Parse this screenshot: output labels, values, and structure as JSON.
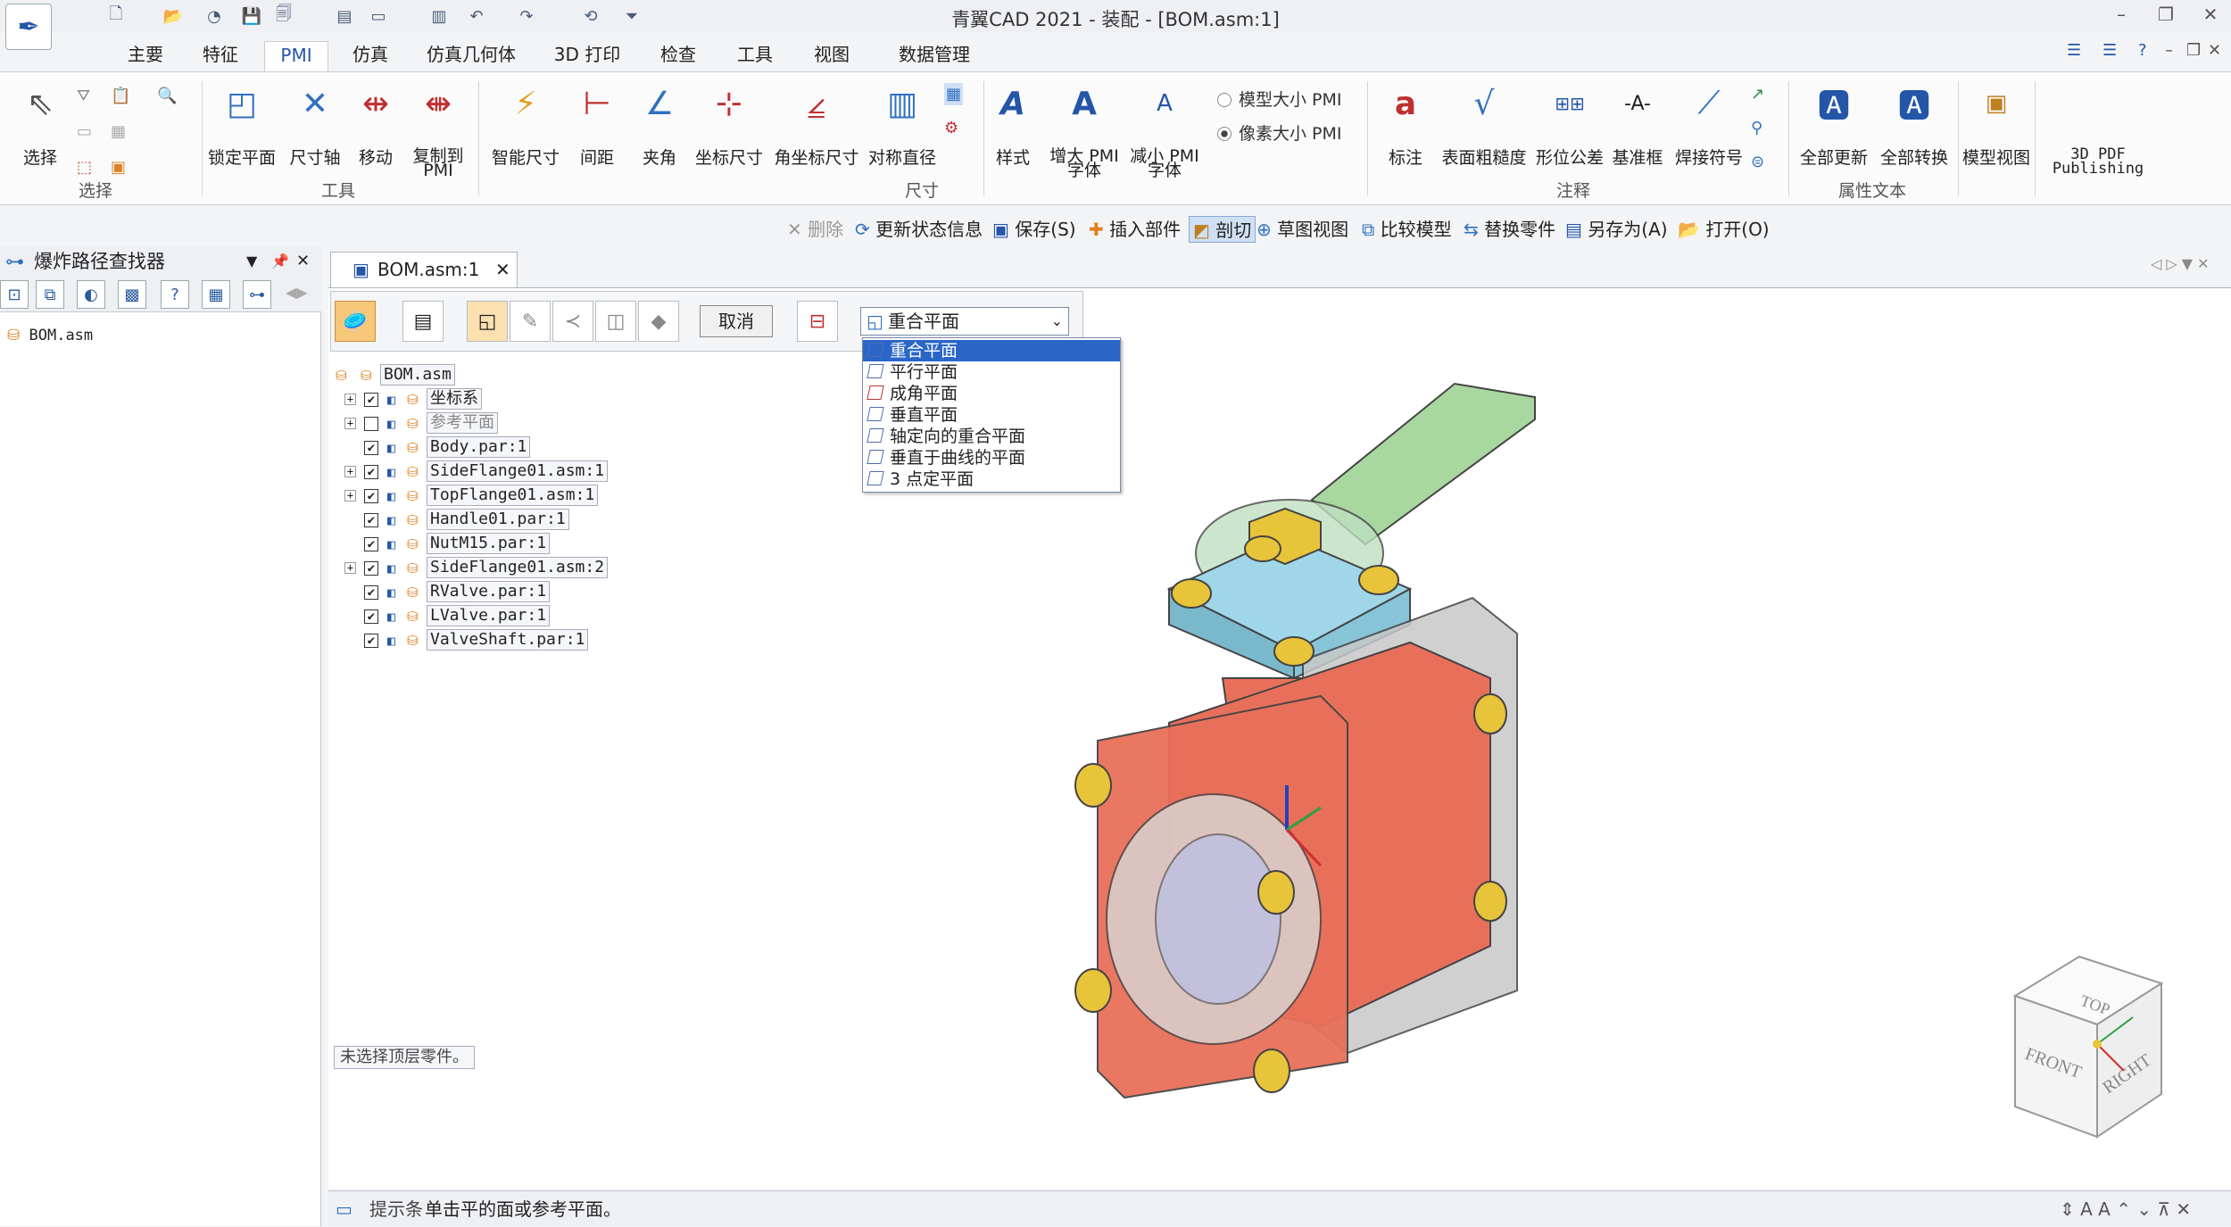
{
  "window": {
    "title": "青翼CAD 2021 - 装配 - [BOM.asm:1]",
    "minimize": "–",
    "restore": "❐",
    "close": "✕"
  },
  "quick_access": [
    "new-icon",
    "open-icon",
    "save-icon",
    "undo-icon",
    "redo-icon"
  ],
  "tabs": [
    "主要",
    "特征",
    "PMI",
    "仿真",
    "仿真几何体",
    "3D 打印",
    "检查",
    "工具",
    "视图",
    "数据管理"
  ],
  "ribbon": {
    "select": {
      "label": "选择",
      "group": "选择"
    },
    "tools": {
      "group": "工具",
      "buttons": [
        "锁定平面",
        "尺寸轴",
        "移动",
        "复制到\nPMI"
      ]
    },
    "dimension": {
      "group": "尺寸",
      "buttons": [
        "智能尺寸",
        "间距",
        "夹角",
        "坐标尺寸",
        "角坐标尺寸",
        "对称直径"
      ]
    },
    "style": {
      "buttons": [
        "样式",
        "增大 PMI\n字体",
        "减小 PMI\n字体"
      ]
    },
    "pmi_size": {
      "model": "模型大小 PMI",
      "pixel": "像素大小 PMI"
    },
    "annotation": {
      "group": "注释",
      "buttons": [
        "标注",
        "表面粗糙度",
        "形位公差",
        "基准框",
        "焊接符号"
      ]
    },
    "attr_text": {
      "group": "属性文本",
      "buttons": [
        "全部更新",
        "全部转换"
      ]
    },
    "model_view": "模型视图",
    "pdf": "3D PDF\nPublishing"
  },
  "cmdbar": {
    "delete": "删除",
    "update": "更新状态信息",
    "save": "保存(S)",
    "insert": "插入部件",
    "section": "剖切",
    "sketch": "草图视图",
    "compare": "比较模型",
    "replace": "替换零件",
    "saveas": "另存为(A)",
    "open": "打开(O)"
  },
  "left_panel": {
    "title": "爆炸路径查找器",
    "item": "BOM.asm"
  },
  "doc_tab": "BOM.asm:1",
  "pathbar": {
    "cancel": "取消",
    "combo_value": "重合平面"
  },
  "dropdown": [
    "重合平面",
    "平行平面",
    "成角平面",
    "垂直平面",
    "轴定向的重合平面",
    "垂直于曲线的平面",
    "3 点定平面"
  ],
  "tree": [
    {
      "label": "BOM.asm",
      "level": 0
    },
    {
      "label": "坐标系",
      "level": 1,
      "expand": true,
      "checked": true
    },
    {
      "label": "参考平面",
      "level": 1,
      "expand": true,
      "checked": false
    },
    {
      "label": "Body.par:1",
      "level": 1,
      "expand": false,
      "checked": true
    },
    {
      "label": "SideFlange01.asm:1",
      "level": 1,
      "expand": true,
      "checked": true
    },
    {
      "label": "TopFlange01.asm:1",
      "level": 1,
      "expand": true,
      "checked": true
    },
    {
      "label": "Handle01.par:1",
      "level": 1,
      "expand": false,
      "checked": true
    },
    {
      "label": "NutM15.par:1",
      "level": 1,
      "expand": false,
      "checked": true
    },
    {
      "label": "SideFlange01.asm:2",
      "level": 1,
      "expand": true,
      "checked": true
    },
    {
      "label": "RValve.par:1",
      "level": 1,
      "expand": false,
      "checked": true
    },
    {
      "label": "LValve.par:1",
      "level": 1,
      "expand": false,
      "checked": true
    },
    {
      "label": "ValveShaft.par:1",
      "level": 1,
      "expand": false,
      "checked": true
    }
  ],
  "hint": "未选择顶层零件。",
  "navcube": {
    "top": "TOP",
    "front": "FRONT",
    "right": "RIGHT"
  },
  "status": {
    "label": "提示条",
    "text": "单击平的面或参考平面。"
  },
  "colors": {
    "accent": "#2a66c8",
    "body": "#e8705a",
    "flange": "#9fd6e8",
    "bolt": "#e8c43a",
    "handle": "#a8d8a0"
  }
}
